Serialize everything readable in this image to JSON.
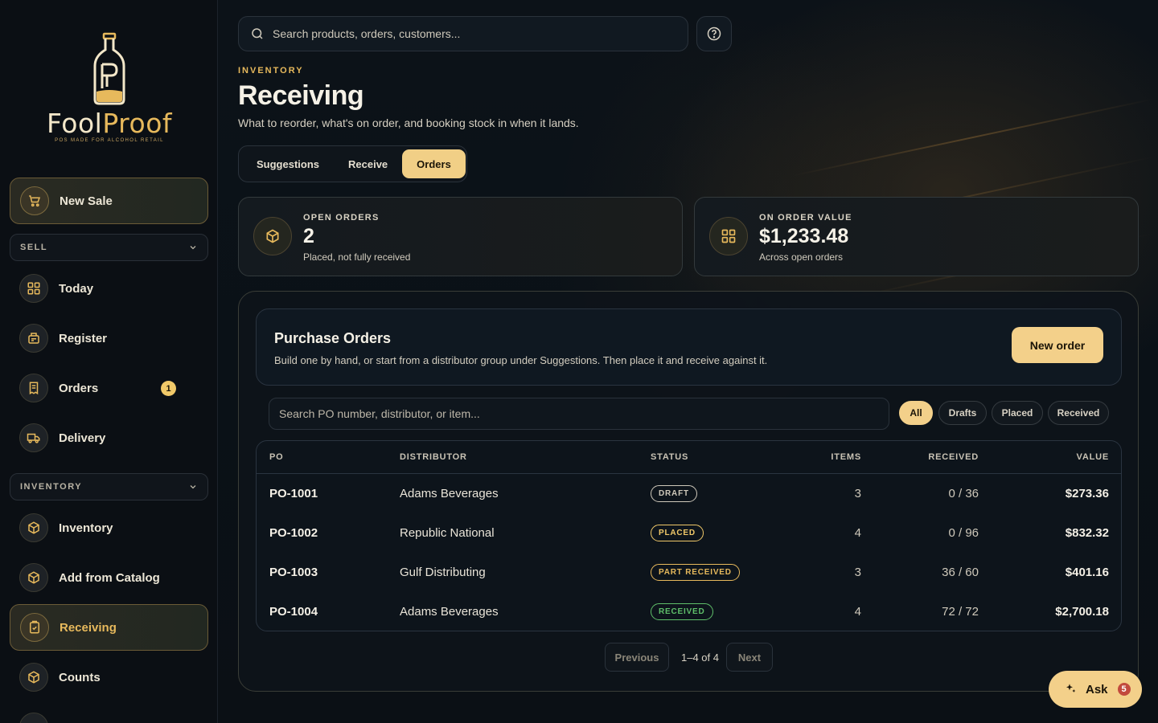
{
  "brand": {
    "name_part1": "Fool",
    "name_part2": "Proof",
    "tagline": "POS MADE FOR ALCOHOL RETAIL"
  },
  "sidebar": {
    "new_sale": "New Sale",
    "sections": {
      "sell": "SELL",
      "inventory": "INVENTORY"
    },
    "sell_items": [
      {
        "label": "Today",
        "icon": "grid-icon"
      },
      {
        "label": "Register",
        "icon": "register-icon"
      },
      {
        "label": "Orders",
        "icon": "receipt-icon",
        "badge": "1"
      },
      {
        "label": "Delivery",
        "icon": "truck-icon"
      }
    ],
    "inventory_items": [
      {
        "label": "Inventory",
        "icon": "box-icon"
      },
      {
        "label": "Add from Catalog",
        "icon": "box-icon"
      },
      {
        "label": "Receiving",
        "icon": "clipboard-icon",
        "active": true
      },
      {
        "label": "Counts",
        "icon": "box-icon"
      }
    ]
  },
  "search": {
    "placeholder": "Search products, orders, customers..."
  },
  "header": {
    "eyebrow": "INVENTORY",
    "title": "Receiving",
    "subtitle": "What to reorder, what's on order, and booking stock in when it lands."
  },
  "tabs": [
    {
      "label": "Suggestions",
      "active": false
    },
    {
      "label": "Receive",
      "active": false
    },
    {
      "label": "Orders",
      "active": true
    }
  ],
  "stats": {
    "open_orders": {
      "label": "OPEN ORDERS",
      "value": "2",
      "note": "Placed, not fully received"
    },
    "on_order_value": {
      "label": "ON ORDER VALUE",
      "value": "$1,233.48",
      "note": "Across open orders"
    }
  },
  "purchase_orders": {
    "title": "Purchase Orders",
    "description": "Build one by hand, or start from a distributor group under Suggestions. Then place it and receive against it.",
    "new_order_label": "New order",
    "search_placeholder": "Search PO number, distributor, or item...",
    "filters": [
      "All",
      "Drafts",
      "Placed",
      "Received"
    ],
    "columns": {
      "po": "PO",
      "distributor": "DISTRIBUTOR",
      "status": "STATUS",
      "items": "ITEMS",
      "received": "RECEIVED",
      "value": "VALUE"
    },
    "rows": [
      {
        "po": "PO-1001",
        "distributor": "Adams Beverages",
        "status": "DRAFT",
        "items": "3",
        "received": "0 / 36",
        "value": "$273.36"
      },
      {
        "po": "PO-1002",
        "distributor": "Republic National",
        "status": "PLACED",
        "items": "4",
        "received": "0 / 96",
        "value": "$832.32"
      },
      {
        "po": "PO-1003",
        "distributor": "Gulf Distributing",
        "status": "PART RECEIVED",
        "items": "3",
        "received": "36 / 60",
        "value": "$401.16"
      },
      {
        "po": "PO-1004",
        "distributor": "Adams Beverages",
        "status": "RECEIVED",
        "items": "4",
        "received": "72 / 72",
        "value": "$2,700.18"
      }
    ],
    "status_colors": {
      "DRAFT": "#cfc9bb",
      "PLACED": "#f1c969",
      "PART RECEIVED": "#e7b95c",
      "RECEIVED": "#5fbf6a"
    },
    "pagination": {
      "previous": "Previous",
      "info": "1–4 of 4",
      "next": "Next"
    }
  },
  "ask": {
    "label": "Ask",
    "count": "5"
  },
  "colors": {
    "accent": "#f3d08a",
    "gold": "#e7b95c",
    "background": "#0a1016"
  }
}
